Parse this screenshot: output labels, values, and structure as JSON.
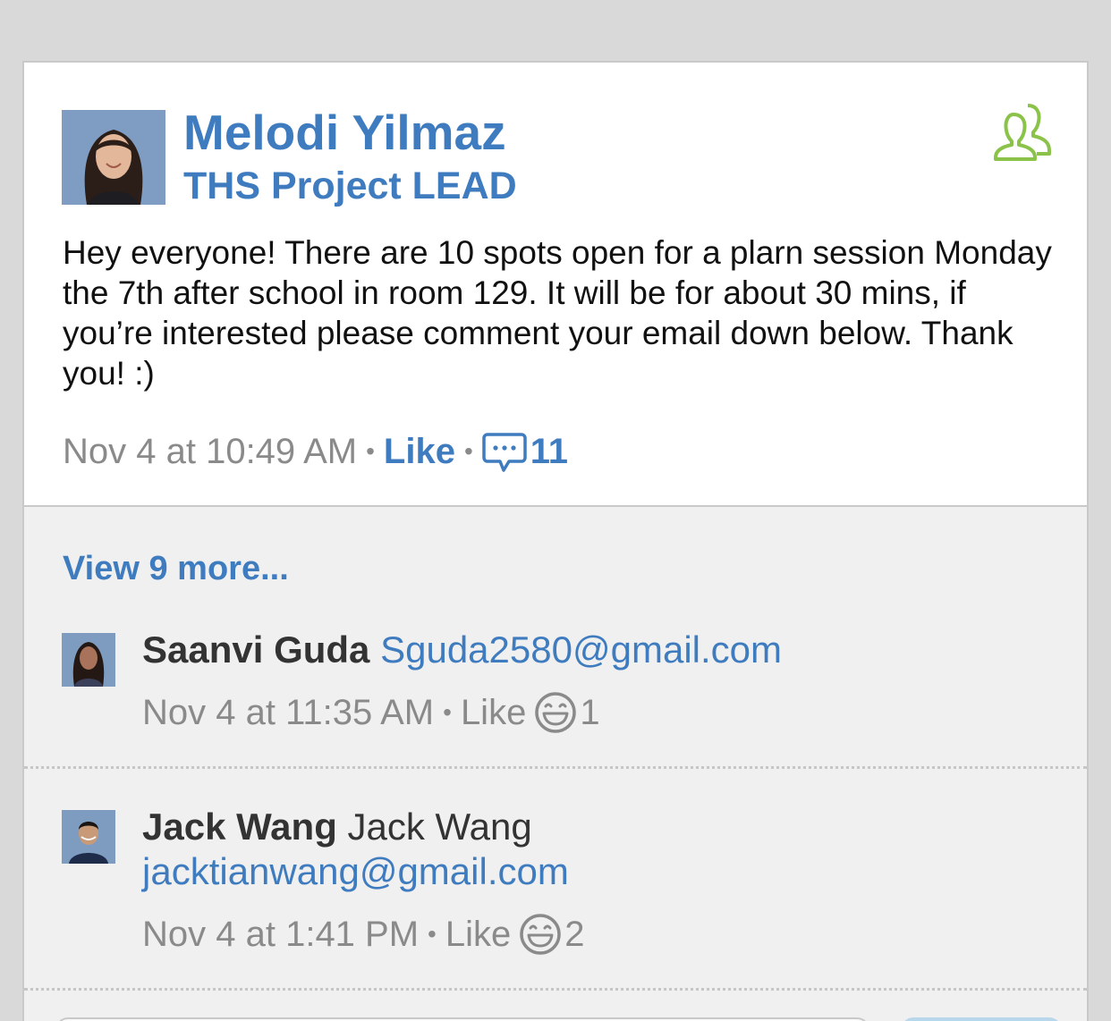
{
  "post": {
    "author_name": "Melodi Yilmaz",
    "group_name": "THS Project LEAD",
    "body": "Hey everyone! There are 10 spots open for a plarn session Monday the 7th after school in room 129. It will be for about 30 mins, if you’re interested please comment your email down below. Thank you! :)",
    "timestamp": "Nov 4 at 10:49 AM",
    "separator": "•",
    "like_label": "Like",
    "comment_count": "11",
    "icons": [
      "group-icon",
      "comment-icon"
    ]
  },
  "comments_section": {
    "view_more_label": "View 9 more..."
  },
  "comments": [
    {
      "author": "Saanvi Guda",
      "text": "Sguda2580@gmail.com",
      "timestamp": "Nov 4 at 11:35 AM",
      "like_label": "Like",
      "reaction_count": "1"
    },
    {
      "author": "Jack Wang",
      "text_plain": "Jack Wang",
      "text": "jacktianwang@gmail.com",
      "timestamp": "Nov 4 at 1:41 PM",
      "like_label": "Like",
      "reaction_count": "2"
    }
  ],
  "colors": {
    "link_blue": "#3f7cbf",
    "group_icon_green": "#8bc34a",
    "meta_gray": "#8a8a8a",
    "background": "#d9d9d9"
  }
}
